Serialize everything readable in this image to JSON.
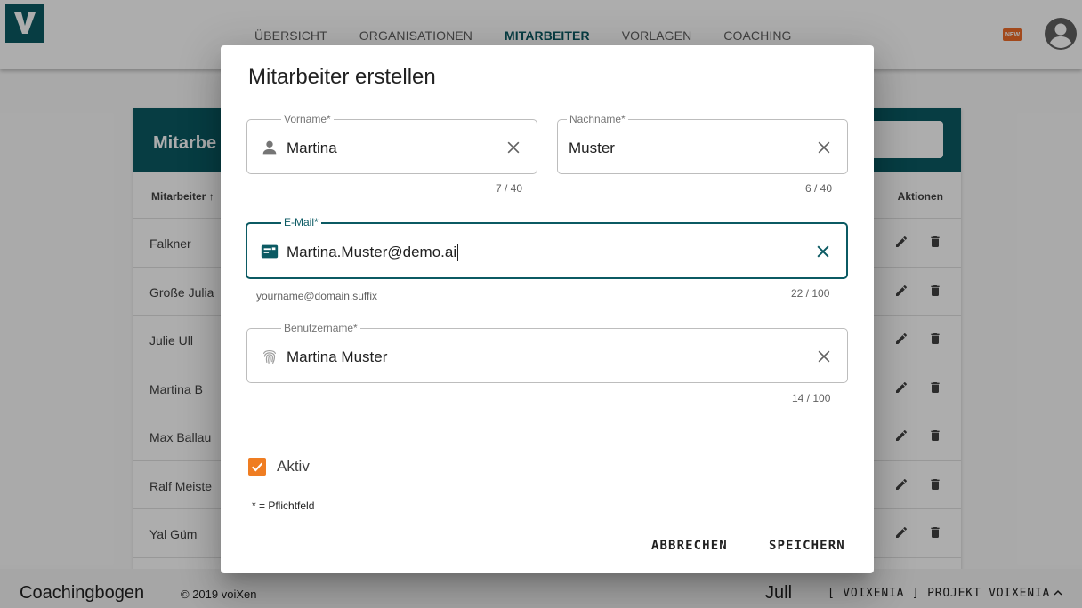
{
  "app": {
    "logo_letter": "V",
    "nav": [
      {
        "label": "ÜBERSICHT",
        "active": false
      },
      {
        "label": "ORGANISATIONEN",
        "active": false
      },
      {
        "label": "MITARBEITER",
        "active": true
      },
      {
        "label": "VORLAGEN",
        "active": false
      },
      {
        "label": "COACHING",
        "active": false
      }
    ],
    "new_badge": "NEW",
    "colors": {
      "primary": "#0b5a63",
      "accent": "#ef7d22",
      "badge": "#ef6c2a"
    }
  },
  "card": {
    "title": "Mitarbe",
    "col_name": "Mitarbeiter",
    "col_actions": "Aktionen",
    "rows": [
      "Falkner",
      "Große Julia",
      "Julie Ull",
      "Martina B",
      "Max Ballau",
      "Ralf Meiste",
      "Yal Güm"
    ]
  },
  "footer": {
    "app_name": "Coachingbogen",
    "copyright": "© 2019 voiXen",
    "user": "Jull",
    "project": "[ VOIXENIA ] PROJEKT VOIXENIA"
  },
  "dialog": {
    "title": "Mitarbeiter erstellen",
    "fields": {
      "firstname": {
        "label": "Vorname*",
        "value": "Martina",
        "counter": "7 / 40",
        "icon": "person-icon"
      },
      "lastname": {
        "label": "Nachname*",
        "value": "Muster",
        "counter": "6 / 40"
      },
      "email": {
        "label": "E-Mail*",
        "value": "Martina.Muster@demo.ai",
        "counter": "22 / 100",
        "hint": "yourname@domain.suffix",
        "icon": "contact-mail-icon"
      },
      "username": {
        "label": "Benutzername*",
        "value": "Martina Muster",
        "counter": "14 / 100",
        "icon": "fingerprint-icon"
      }
    },
    "active_label": "Aktiv",
    "active_checked": true,
    "required_note": "* = Pflichtfeld",
    "cancel_label": "ABBRECHEN",
    "save_label": "SPEICHERN"
  }
}
